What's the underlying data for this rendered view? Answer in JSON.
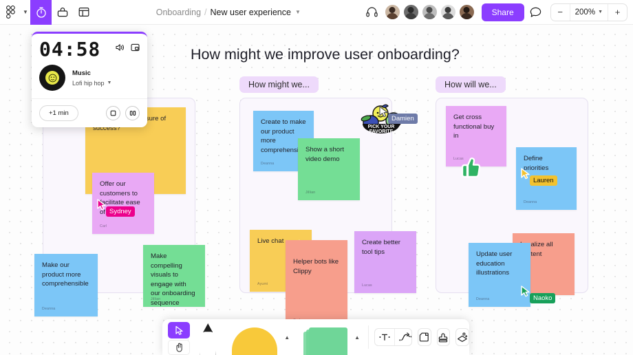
{
  "topbar": {
    "logo_icon": "figjam-logo-icon",
    "menu_caret_icon": "chevron-down-icon",
    "tools": [
      {
        "name": "timer-icon",
        "active": true
      },
      {
        "name": "toolbox-icon",
        "active": false
      },
      {
        "name": "layout-panel-icon",
        "active": false
      }
    ],
    "breadcrumb_parent": "Onboarding",
    "breadcrumb_separator": "/",
    "breadcrumb_current": "New user experience",
    "breadcrumb_caret_icon": "chevron-down-icon",
    "headset_icon": "headset-icon",
    "collaborators": [
      "avatar-1",
      "avatar-2",
      "avatar-3",
      "avatar-4",
      "avatar-5"
    ],
    "share_label": "Share",
    "comment_icon": "comment-bubble-icon",
    "zoom_out_label": "−",
    "zoom_value": "200%",
    "zoom_caret_icon": "chevron-down-icon",
    "zoom_in_label": "+"
  },
  "widget": {
    "time": "04:58",
    "volume_icon": "volume-icon",
    "popout_icon": "popout-icon",
    "album_icon": "vinyl-record-icon",
    "music_label": "Music",
    "track_label": "Lofi hip hop",
    "track_caret_icon": "chevron-down-icon",
    "add_minute_label": "+1 min",
    "stop_icon": "stop-icon",
    "pause_icon": "pause-icon"
  },
  "board": {
    "title": "How might we improve user onboarding?",
    "sticker_label_line1": "PICK YOUR",
    "sticker_label_line2": "FAVORITE"
  },
  "frames": [
    {
      "label": "",
      "notes": [
        {
          "text": "…establish a measure of success?",
          "author": "",
          "color": "#f8cd56"
        },
        {
          "text": "Offer our customers to facilitate ease of use",
          "author": "Carl",
          "color": "#e9a9f5"
        },
        {
          "text": "Make our product more comprehensible",
          "author": "Deanna",
          "color": "#7cc6f7"
        },
        {
          "text": "Make compelling visuals to engage with our onboarding sequence",
          "author": "Jillian",
          "color": "#74de95"
        }
      ]
    },
    {
      "label": "How might we...",
      "notes": [
        {
          "text": "Create to make our product more comprehensible",
          "author": "Deanna",
          "color": "#7cc6f7"
        },
        {
          "text": "Show a short video demo",
          "author": "Jillian",
          "color": "#74de95"
        },
        {
          "text": "Live chat",
          "author": "Ayumi",
          "color": "#f8cd56"
        },
        {
          "text": "Create better tool tips",
          "author": "Lucas",
          "color": "#dba5f7"
        },
        {
          "text": "Helper bots like Clippy",
          "author": "Carl",
          "color": "#f79e8c"
        }
      ]
    },
    {
      "label": "How will we...",
      "notes": [
        {
          "text": "Get cross functional buy in",
          "author": "Lucas",
          "color": "#e9a9f5"
        },
        {
          "text": "Define priorities",
          "author": "Deanna",
          "color": "#7cc6f7"
        },
        {
          "text": "Update user education illustrations",
          "author": "Deanna",
          "color": "#7cc6f7"
        },
        {
          "text": "Localize all content",
          "author": "",
          "color": "#f79e8c"
        }
      ]
    }
  ],
  "stamps": {
    "thumbs_up": "thumbs-up-stamp",
    "star": "star-stamp"
  },
  "cursors": [
    {
      "name": "Sydney",
      "color": "#ec008c"
    },
    {
      "name": "Damien",
      "color": "#6e7ba8"
    },
    {
      "name": "Lauren",
      "color": "#f2c230"
    },
    {
      "name": "Naoko",
      "color": "#18a05a"
    }
  ],
  "toolbar": {
    "select_icon": "cursor-select-icon",
    "hand_icon": "hand-pan-icon",
    "pen_icon": "pen-tool-icon",
    "sticky_icon": "sticky-note-tool-icon",
    "sticky_caret_icon": "chevron-up-icon",
    "shape_icon": "shape-tool-icon",
    "shape_caret_icon": "chevron-up-icon",
    "text_icon": "text-tool-icon",
    "connector_icon": "connector-tool-icon",
    "connector_caret_icon": "chevron-up-icon",
    "section_icon": "section-frame-icon",
    "stamp_icon": "stamp-tool-icon",
    "widgets_icon": "widgets-plus-icon"
  }
}
